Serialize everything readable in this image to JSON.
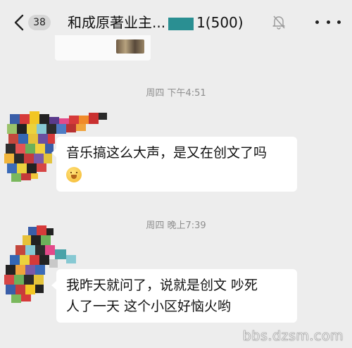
{
  "header": {
    "back_badge": "38",
    "title": "和成原著业主...",
    "title_suffix": "1(500)",
    "icons": {
      "back": "chevron-left-icon",
      "mute": "bell-muted-icon",
      "more": "more-dots-icon"
    }
  },
  "messages": [
    {
      "time": "周四 下午4:51",
      "text_line1": "音乐搞这么大声，是又在创文了吗",
      "emoji": "pleading-face-emoji"
    },
    {
      "time": "周四 晚上7:39",
      "text_line1": "我昨天就问了，说就是创文 吵死",
      "text_line2": "人了一天 这个小区好恼火哟"
    }
  ],
  "watermark": "bbs.dzsm.com",
  "colors": {
    "background": "#ededed",
    "bubble": "#ffffff",
    "time_text": "#8e8e8e"
  }
}
